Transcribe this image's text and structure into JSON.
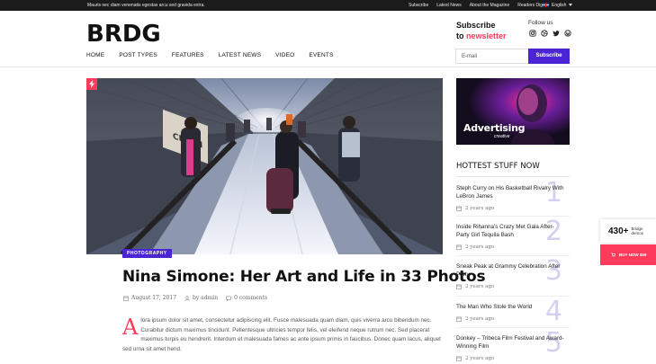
{
  "topbar": {
    "ticker": "Mauris nec diam venenatis egestas arcu sed gravida extra.",
    "links": [
      "Subscribe",
      "Latest News",
      "About the Magazine",
      "Readers Digest"
    ],
    "language": "English"
  },
  "header": {
    "logo": "BRDG",
    "subscribe_line1": "Subscribe",
    "subscribe_to": "to",
    "subscribe_accent": "newsletter",
    "follow_label": "Follow us",
    "socials": [
      "instagram-icon",
      "dribbble-icon",
      "twitter-icon",
      "wordpress-icon"
    ],
    "email_placeholder": "E-mail",
    "subscribe_button": "Subscribe"
  },
  "nav": [
    "HOME",
    "POST TYPES",
    "FEATURES",
    "LATEST NEWS",
    "VIDEO",
    "EVENTS"
  ],
  "post": {
    "category": "PHOTOGRAPHY",
    "title": "Nina Simone: Her Art and Life in 33 Photos",
    "date": "August 17, 2017",
    "author": "by admin",
    "comments": "0 comments",
    "dropcap": "A",
    "excerpt": "lora ipsum dolor sit amet, consectetur adipiscing elit. Fusce malesuada quam diam, quis viverra arcu bibendum nec. Curabitur dictum maximus tincidunt. Pellentesque ultricies tempor felis, vel eleifend neque rutrum nec. Sed placerat maximus turpis eu hendrerit. Interdum et malesuada fames ac ante ipsum primis in faucibus. Donec quam lacus, aliquet sed urna sit amet hend."
  },
  "sidebar": {
    "ad_text": "Advertising",
    "ad_sub": "creative",
    "hot_title": "HOTTEST STUFF NOW",
    "items": [
      {
        "num": "1",
        "title": "Steph Curry on His Basketball Rivalry With LeBron James",
        "date": "2 years ago"
      },
      {
        "num": "2",
        "title": "Inside Rihanna's Crazy Met Gala After-Party Girl Tequila Bash",
        "date": "2 years ago"
      },
      {
        "num": "3",
        "title": "Sneak Peak at Grammy Celebration After Party",
        "date": "2 years ago"
      },
      {
        "num": "4",
        "title": "The Man Who Stole the World",
        "date": "2 years ago"
      },
      {
        "num": "5",
        "title": "Donkey – Tribeca Film Festival and Award-Winning Film",
        "date": "2 years ago"
      }
    ]
  },
  "floating": {
    "demos_count": "430+",
    "demos_label1": "Bridge",
    "demos_label2": "demos",
    "buy_label": "BUY NOW $59"
  },
  "colors": {
    "accent": "#ff3b5c",
    "brand": "#4b24d6",
    "topbar": "#1b1b1b"
  }
}
